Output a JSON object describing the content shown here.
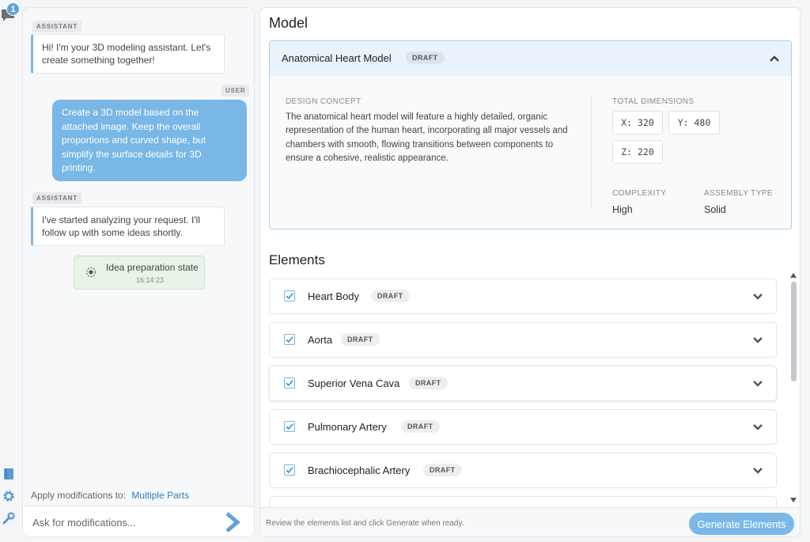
{
  "rail": {
    "badge_count": "1",
    "icons": [
      "chat-icon",
      "book-icon",
      "gear-icon",
      "wrench-icon"
    ]
  },
  "chat": {
    "messages": [
      {
        "role": "ASSISTANT",
        "text": "Hi! I'm your 3D modeling assistant. Let's create something together!"
      },
      {
        "role": "USER",
        "text": "Create a 3D model based on the attached image. Keep the overall proportions and curved shape, but simplify the surface details for 3D printing."
      },
      {
        "role": "ASSISTANT",
        "text": "I've started analyzing your request. I'll follow up with some ideas shortly."
      }
    ],
    "state": {
      "title": "Idea preparation state",
      "time": "16:14:23"
    },
    "apply_label": "Apply modifications to:",
    "apply_target": "Multiple Parts",
    "input_placeholder": "Ask for modifications..."
  },
  "model": {
    "heading": "Model",
    "title": "Anatomical Heart Model",
    "status": "DRAFT",
    "concept_label": "DESIGN CONCEPT",
    "concept_text": "The anatomical heart model will feature a highly detailed, organic representation of the human heart, incorporating all major vessels and chambers with smooth, flowing transitions between components to ensure a cohesive, realistic appearance.",
    "dimensions_label": "TOTAL DIMENSIONS",
    "dim_x": "X: 320",
    "dim_y": "Y: 480",
    "dim_z": "Z: 220",
    "complexity_label": "COMPLEXITY",
    "complexity": "High",
    "assembly_label": "ASSEMBLY TYPE",
    "assembly": "Solid"
  },
  "elements": {
    "heading": "Elements",
    "items": [
      {
        "name": "Heart Body",
        "status": "DRAFT",
        "checked": true
      },
      {
        "name": "Aorta",
        "status": "DRAFT",
        "checked": true
      },
      {
        "name": "Superior Vena Cava",
        "status": "DRAFT",
        "checked": true
      },
      {
        "name": "Pulmonary Artery",
        "status": "DRAFT",
        "checked": true
      },
      {
        "name": "Brachiocephalic Artery",
        "status": "DRAFT",
        "checked": true
      }
    ]
  },
  "footer": {
    "hint": "Review the elements list and click Generate when ready.",
    "generate_label": "Generate Elements"
  },
  "colors": {
    "accent": "#78b7e6",
    "link": "#2d7fc1",
    "state_bg": "#e8f4e8"
  }
}
